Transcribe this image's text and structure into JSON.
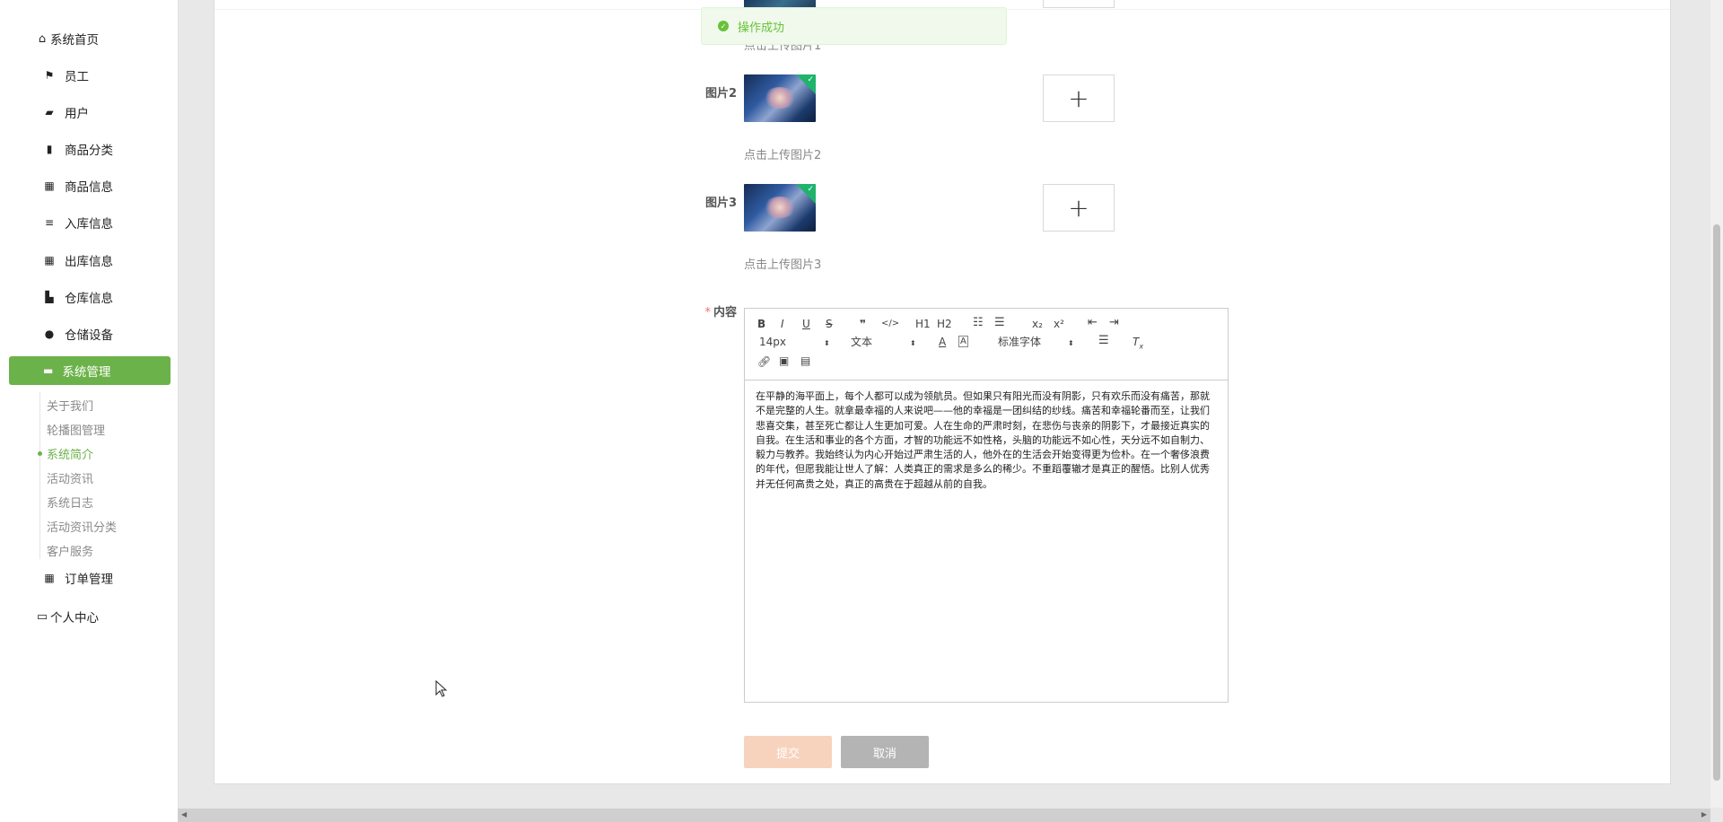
{
  "sidebar": {
    "home": {
      "label": "系统首页",
      "icon": "home-icon"
    },
    "items": [
      {
        "label": "员工",
        "icon": "flag-icon"
      },
      {
        "label": "用户",
        "icon": "briefcase-icon"
      },
      {
        "label": "商品分类",
        "icon": "clipboard-icon"
      },
      {
        "label": "商品信息",
        "icon": "grid-icon"
      },
      {
        "label": "入库信息",
        "icon": "list-icon"
      },
      {
        "label": "出库信息",
        "icon": "grid-icon"
      },
      {
        "label": "仓库信息",
        "icon": "truck-icon"
      },
      {
        "label": "仓储设备",
        "icon": "user-icon"
      }
    ],
    "active": {
      "label": "系统管理",
      "icon": "monitor-icon"
    },
    "sub_items": [
      "关于我们",
      "轮播图管理",
      "系统简介",
      "活动资讯",
      "系统日志",
      "活动资讯分类",
      "客户服务"
    ],
    "current_sub": "系统简介",
    "order": {
      "label": "订单管理",
      "icon": "grid-icon"
    },
    "profile": {
      "label": "个人中心",
      "icon": "card-icon"
    }
  },
  "form": {
    "image1_hint": "点击上传图片1",
    "image2_label": "图片2",
    "image2_hint": "点击上传图片2",
    "image3_label": "图片3",
    "image3_hint": "点击上传图片3",
    "content_label": "内容",
    "required_mark": "*",
    "upload_plus": "+"
  },
  "editor": {
    "toolbar_row1": [
      "B",
      "I",
      "U",
      "S",
      "❞",
      "</>",
      "H1",
      "H2",
      "ol",
      "ul",
      "x₂",
      "x²",
      "outdent",
      "indent"
    ],
    "font_size": "14px",
    "text_type": "文本",
    "font_family": "标准字体",
    "content": "在平静的海平面上，每个人都可以成为领航员。但如果只有阳光而没有阴影，只有欢乐而没有痛苦，那就不是完整的人生。就拿最幸福的人来说吧——他的幸福是一团纠结的纱线。痛苦和幸福轮番而至，让我们悲喜交集，甚至死亡都让人生更加可爱。人在生命的严肃时刻，在悲伤与丧亲的阴影下，才最接近真实的自我。在生活和事业的各个方面，才智的功能远不如性格，头脑的功能远不如心性，天分远不如自制力、毅力与教养。我始终认为内心开始过严肃生活的人，他外在的生活会开始变得更为俭朴。在一个奢侈浪费的年代，但愿我能让世人了解：人类真正的需求是多么的稀少。不重蹈覆辙才是真正的醒悟。比别人优秀并无任何高贵之处，真正的高贵在于超越从前的自我。"
  },
  "buttons": {
    "submit": "提交",
    "cancel": "取消"
  },
  "toast": {
    "message": "操作成功"
  },
  "colors": {
    "accent": "#6cb24a",
    "success": "#67c23a",
    "submit_disabled": "#f7d3bd",
    "cancel": "#b4b4b4"
  }
}
